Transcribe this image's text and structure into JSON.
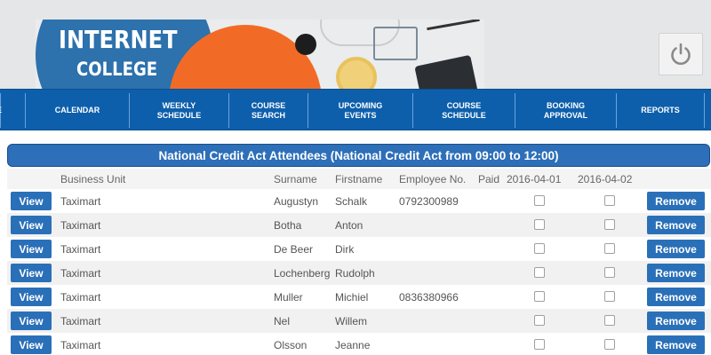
{
  "brand": {
    "line1": "INTERNET",
    "line2": "COLLEGE"
  },
  "header": {
    "power_icon": "power-icon"
  },
  "nav": {
    "items": [
      {
        "label": "CALENDAR"
      },
      {
        "label": "WEEKLY\nSCHEDULE"
      },
      {
        "label": "COURSE\nSEARCH"
      },
      {
        "label": "UPCOMING\nEVENTS"
      },
      {
        "label": "COURSE\nSCHEDULE"
      },
      {
        "label": "BOOKING\nAPPROVAL"
      },
      {
        "label": "REPORTS"
      }
    ]
  },
  "page": {
    "title": "National Credit Act Attendees (National Credit Act from 09:00 to 12:00)"
  },
  "table": {
    "columns": [
      "Business Unit",
      "Surname",
      "Firstname",
      "Employee No.",
      "Paid",
      "2016-04-01",
      "2016-04-02"
    ],
    "view_label": "View",
    "remove_label": "Remove",
    "rows": [
      {
        "business_unit": "Taximart",
        "surname": "Augustyn",
        "firstname": "Schalk",
        "employee_no": "0792300989"
      },
      {
        "business_unit": "Taximart",
        "surname": "Botha",
        "firstname": "Anton",
        "employee_no": ""
      },
      {
        "business_unit": "Taximart",
        "surname": "De Beer",
        "firstname": "Dirk",
        "employee_no": ""
      },
      {
        "business_unit": "Taximart",
        "surname": "Lochenberg",
        "firstname": "Rudolph",
        "employee_no": ""
      },
      {
        "business_unit": "Taximart",
        "surname": "Muller",
        "firstname": "Michiel",
        "employee_no": "0836380966"
      },
      {
        "business_unit": "Taximart",
        "surname": "Nel",
        "firstname": "Willem",
        "employee_no": ""
      },
      {
        "business_unit": "Taximart",
        "surname": "Olsson",
        "firstname": "Jeanne",
        "employee_no": ""
      }
    ]
  },
  "colors": {
    "nav_bg": "#0d5fac",
    "button_bg": "#2a70b8",
    "title_bg": "#2d6fb8",
    "accent_orange": "#f26b26"
  }
}
